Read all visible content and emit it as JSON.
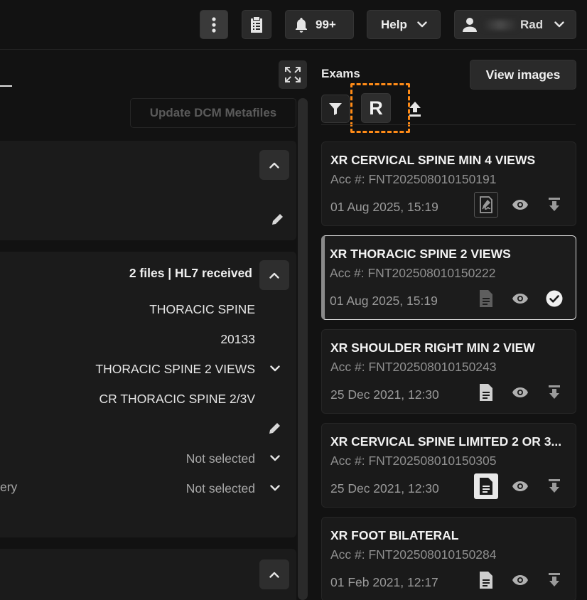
{
  "topbar": {
    "notifications_count": "99+",
    "help_label": "Help",
    "user_name_visible": "Rad"
  },
  "left_panel": {
    "update_dcm_label": "Update DCM Metafiles",
    "card2": {
      "files_status": "2 files | HL7 received",
      "rows": [
        {
          "value": "THORACIC SPINE"
        },
        {
          "value": "20133"
        },
        {
          "value": "THORACIC SPINE 2 VIEWS"
        },
        {
          "value": "CR THORACIC SPINE 2/3V"
        }
      ],
      "selects": [
        {
          "label": "",
          "value": "Not selected"
        },
        {
          "label": "ery",
          "value": "Not selected"
        }
      ]
    }
  },
  "exams_panel": {
    "title": "Exams",
    "view_images_label": "View images",
    "r_button_label": "R",
    "exams": [
      {
        "title": "XR CERVICAL SPINE MIN 4 VIEWS",
        "acc": "Acc #: FNT202508010150191",
        "date": "01 Aug 2025, 15:19",
        "status_icon": "report-signed-icon",
        "action_icon": "download-icon"
      },
      {
        "title": "XR THORACIC SPINE 2 VIEWS",
        "acc": "Acc #: FNT202508010150222",
        "date": "01 Aug 2025, 15:19",
        "status_icon": "document-icon",
        "action_icon": "check-circle-icon"
      },
      {
        "title": "XR SHOULDER RIGHT MIN 2 VIEW",
        "acc": "Acc #: FNT202508010150243",
        "date": "25 Dec 2021, 12:30",
        "status_icon": "document-icon",
        "action_icon": "download-icon"
      },
      {
        "title": "XR CERVICAL SPINE LIMITED 2 OR 3...",
        "acc": "Acc #: FNT202508010150305",
        "date": "25 Dec 2021, 12:30",
        "status_icon": "document-icon",
        "action_icon": "download-icon"
      },
      {
        "title": "XR FOOT BILATERAL",
        "acc": "Acc #: FNT202508010150284",
        "date": "01 Feb 2021, 12:17",
        "status_icon": "document-icon",
        "action_icon": "download-icon"
      }
    ]
  },
  "colors": {
    "background": "#121212",
    "highlight_dashed": "#ff8b17",
    "active_border": "#d9d9d9"
  }
}
